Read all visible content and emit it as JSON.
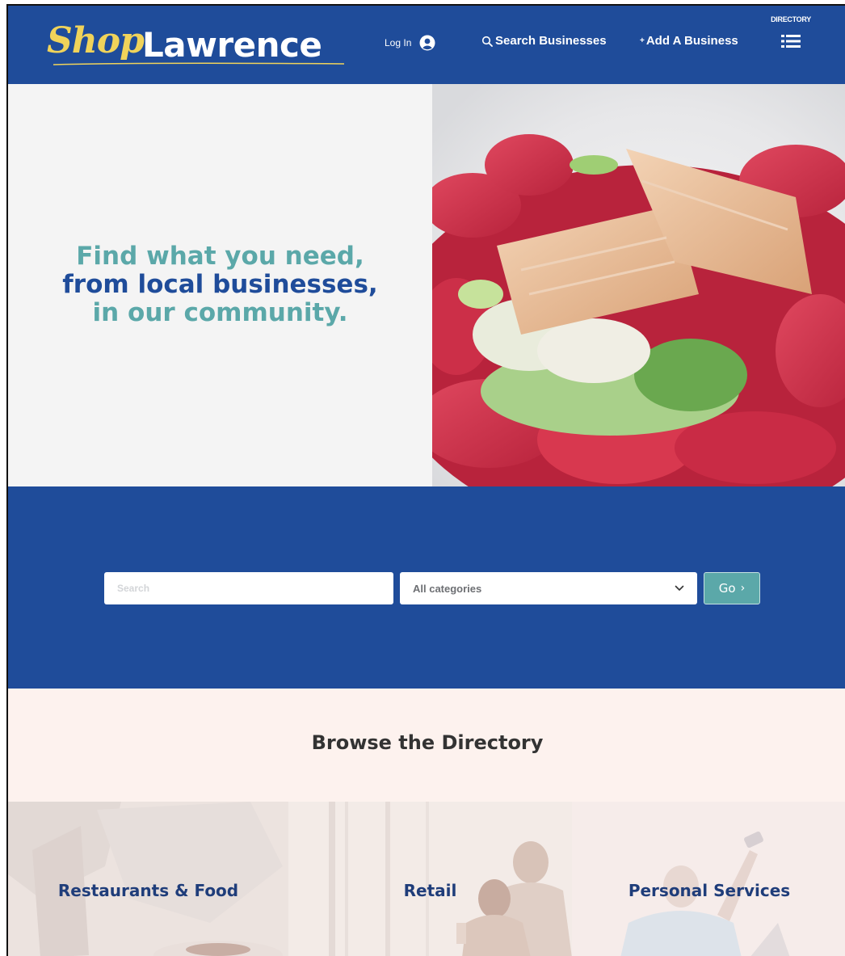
{
  "header": {
    "logo_script": "Shop",
    "logo_word": "Lawrence",
    "login_label": "Log In",
    "search_label": "Search Businesses",
    "add_label": "Add A Business",
    "directory_label": "DIRECTORY",
    "icons": {
      "login": "user-circle-icon",
      "search": "search-icon",
      "add": "plus-icon",
      "directory": "list-icon"
    }
  },
  "hero": {
    "line1": "Find what you need,",
    "line2": "from local businesses,",
    "line3": "in our community."
  },
  "search": {
    "placeholder": "Search",
    "category_selected": "All categories",
    "go_label": "Go",
    "go_chevron": "›"
  },
  "browse": {
    "title": "Browse the Directory",
    "categories": [
      {
        "label": "Restaurants & Food"
      },
      {
        "label": "Retail"
      },
      {
        "label": "Personal Services"
      }
    ]
  },
  "colors": {
    "brand_blue": "#1f4c9a",
    "teal": "#5ba8a9",
    "logo_yellow": "#f0d35a",
    "browse_bg": "#fdf2ee"
  }
}
